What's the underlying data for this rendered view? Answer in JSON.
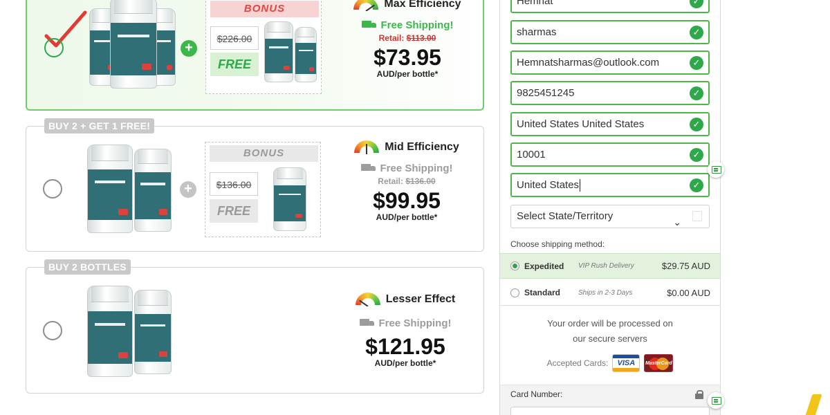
{
  "packages": [
    {
      "tag": "",
      "efficiency": "Max Efficiency",
      "shipping": "Free Shipping!",
      "retail_label": "Retail:",
      "retail_price": "$113.00",
      "price": "$73.95",
      "per_unit": "AUD/per bottle*",
      "bonus_label": "BONUS",
      "bonus_old_price": "$226.00",
      "bonus_free": "FREE",
      "selected": true
    },
    {
      "tag": "BUY 2 + GET 1 FREE!",
      "efficiency": "Mid Efficiency",
      "shipping": "Free Shipping!",
      "retail_label": "Retail:",
      "retail_price": "$136.00",
      "price": "$99.95",
      "per_unit": "AUD/per bottle*",
      "bonus_label": "BONUS",
      "bonus_old_price": "$136.00",
      "bonus_free": "FREE",
      "selected": false
    },
    {
      "tag": "BUY 2 BOTTLES",
      "efficiency": "Lesser Effect",
      "shipping": "Free Shipping!",
      "price": "$121.95",
      "per_unit": "AUD/per bottle*",
      "selected": false
    }
  ],
  "form": {
    "first_name": "Hemnat",
    "last_name": "sharmas",
    "email": "Hemnatsharmas@outlook.com",
    "phone": "9825451245",
    "address": "United States United States",
    "zip": "10001",
    "country": "United States",
    "state_placeholder": "Select State/Territory"
  },
  "shipping": {
    "title": "Choose shipping method:",
    "options": [
      {
        "name": "Expedited",
        "sub": "VIP Rush Delivery",
        "price": "$29.75 AUD",
        "selected": true
      },
      {
        "name": "Standard",
        "sub": "Ships in 2-3 Days",
        "price": "$0.00 AUD",
        "selected": false
      }
    ]
  },
  "secure": {
    "line1": "Your order will be processed on",
    "line2": "our secure servers",
    "accepted": "Accepted Cards:",
    "visa": "VISA",
    "mastercard": "MasterCard"
  },
  "card": {
    "label": "Card Number:"
  },
  "icons": {
    "check": "checkmark-icon",
    "valid": "check-circle-icon",
    "truck": "truck-icon",
    "gauge": "gauge-icon",
    "lock": "lock-icon",
    "extension": "form-filler-icon"
  },
  "colors": {
    "accent_green": "#2ea84a",
    "selected_border": "#6fce6a",
    "bonus_pink": "#f7d3d3",
    "free_green": "#d8f1d2",
    "retail_red": "#d62d2d"
  }
}
